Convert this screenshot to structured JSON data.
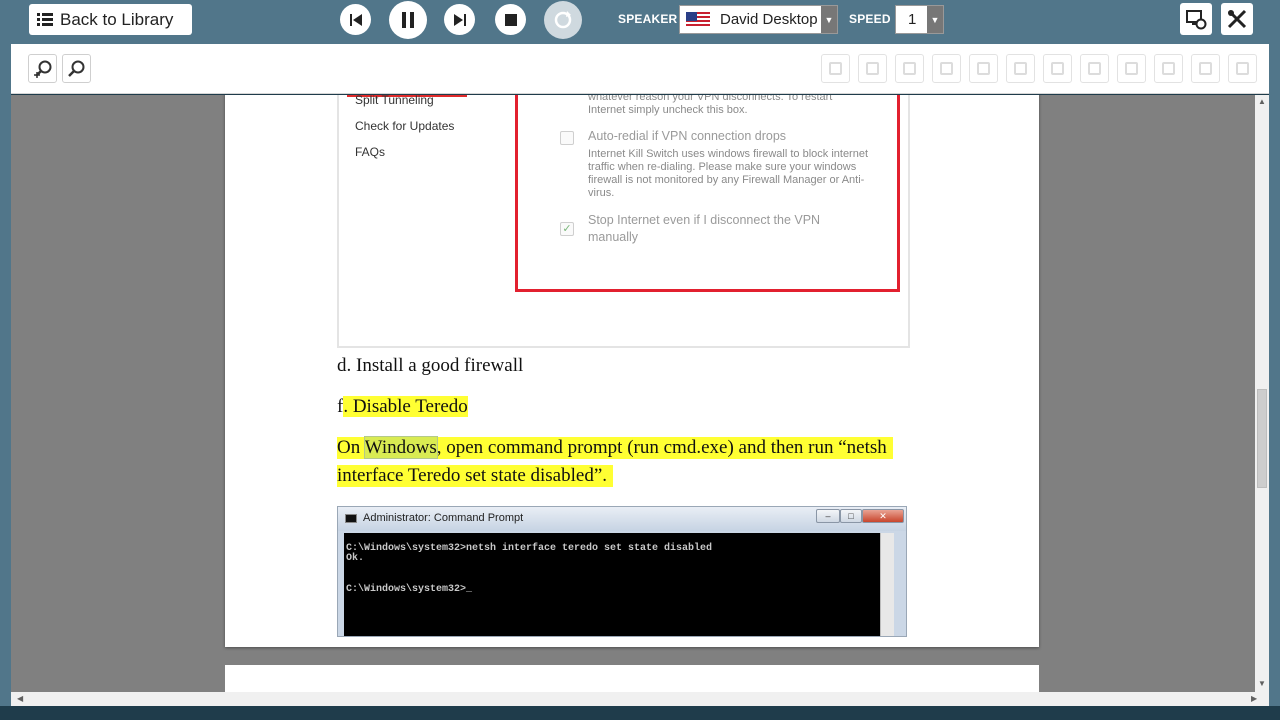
{
  "topbar": {
    "back_label": "Back to Library",
    "speaker_label": "SPEAKER",
    "speaker_value": "David Desktop",
    "speed_label": "SPEED",
    "speed_value": "1"
  },
  "settings_panel": {
    "side_links": [
      "Split Tunneling",
      "Check for Updates",
      "FAQs"
    ],
    "option_top_text": "whatever reason your VPN disconnects. To restart Internet simply uncheck this box.",
    "option1_title": "Auto-redial if VPN connection drops",
    "option1_text": "Internet Kill Switch uses windows firewall to block internet traffic when re-dialing. Please make sure your windows firewall is not monitored by any Firewall Manager or Anti-virus.",
    "option2_title": "Stop Internet even if I disconnect the VPN manually"
  },
  "document": {
    "line_d": "d. Install a good firewall",
    "line_f_prefix": "f",
    "line_f_rest": ". Disable Teredo",
    "para_on": "On ",
    "para_word": "Windows",
    "para_line1_rest": ", open command prompt (run cmd.exe) and then run “netsh",
    "para_line2": "interface Teredo set state disabled”."
  },
  "cmd_window": {
    "title": "Administrator: Command Prompt",
    "line1": "C:\\Windows\\system32>netsh interface teredo set state disabled",
    "line2": "Ok.",
    "line3": "C:\\Windows\\system32>_"
  },
  "colors": {
    "topbar": "#51768a",
    "highlight": "#ffff33",
    "red_box": "#e2202f"
  }
}
